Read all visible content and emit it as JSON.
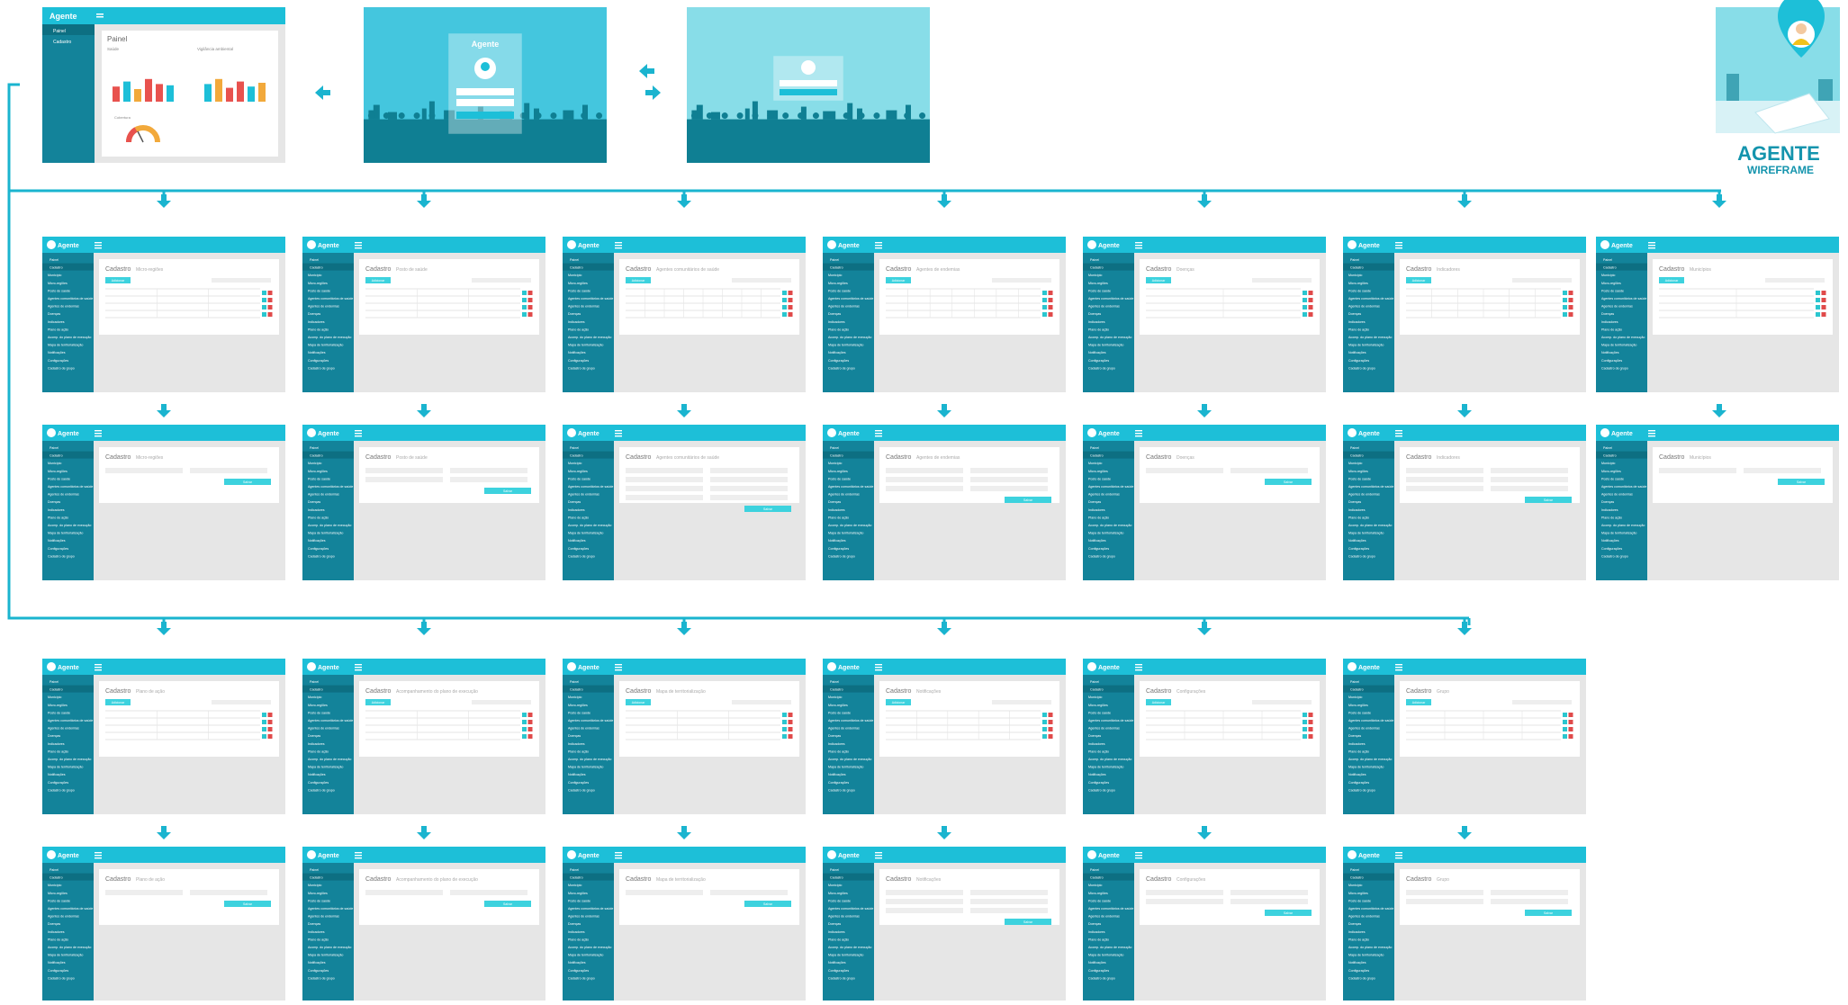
{
  "brand": {
    "app_name": "Agente",
    "logo_title": "AGENTE",
    "logo_subtitle": "WIREFRAME"
  },
  "colors": {
    "primary": "#1dbfd8",
    "sidebar": "#13839a",
    "sidebar_dark": "#0d6f82",
    "content_bg": "#e6e6e6",
    "card": "#ffffff",
    "flow_line": "#1ab4cf",
    "add_button": "#3dd2de",
    "edit_icon": "#2bc6cf",
    "delete_icon": "#e04a4a",
    "sky_dark": "#44c6de",
    "sky_light": "#88dde8",
    "ground": "#0f7f93",
    "logo_text": "#1494ad"
  },
  "icons": {
    "menu": "hamburger-icon",
    "arrow_down": "arrow-down-icon",
    "arrow_left": "arrow-left-icon",
    "arrow_right": "arrow-right-icon",
    "edit": "edit-icon",
    "delete": "delete-icon",
    "location_pin": "location-pin-icon",
    "map": "map-icon"
  },
  "flow": {
    "dashboard_screen": {
      "title": "Painel",
      "section_left": "Saúde",
      "section_right": "Vigilância ambiental",
      "gauge_label": "Cobertura",
      "sidebar": [
        "Painel",
        "Cadastro"
      ]
    },
    "sidebar_menu": [
      "Painel",
      "Cadastro",
      "Município",
      "Micro-regiões",
      "Posto de saúde",
      "Agentes comunitários de saúde",
      "Agentes de endemias",
      "Doenças",
      "Indicadores",
      "Plano de ação",
      "Acomp. do plano de execução",
      "Mapa de territorialização",
      "Notificações",
      "Configurações",
      "Cadastro de grupo"
    ],
    "list_button": "Adicionar",
    "save_button": "Salvar",
    "row1_screens": [
      {
        "title": "Cadastro",
        "subtitle": "Micro-regiões"
      },
      {
        "title": "Cadastro",
        "subtitle": "Posto de saúde"
      },
      {
        "title": "Cadastro",
        "subtitle": "Agentes comunitários de saúde"
      },
      {
        "title": "Cadastro",
        "subtitle": "Agentes de endemias"
      },
      {
        "title": "Cadastro",
        "subtitle": "Doenças"
      },
      {
        "title": "Cadastro",
        "subtitle": "Indicadores"
      },
      {
        "title": "Cadastro",
        "subtitle": "Municípios"
      }
    ],
    "row2_screens": [
      {
        "title": "Cadastro",
        "subtitle": "Plano de ação"
      },
      {
        "title": "Cadastro",
        "subtitle": "Acompanhamento do plano de execução"
      },
      {
        "title": "Cadastro",
        "subtitle": "Mapa de territorialização"
      },
      {
        "title": "Cadastro",
        "subtitle": "Notificações"
      },
      {
        "title": "Cadastro",
        "subtitle": "Configurações"
      },
      {
        "title": "Cadastro",
        "subtitle": "Grupo"
      }
    ]
  }
}
